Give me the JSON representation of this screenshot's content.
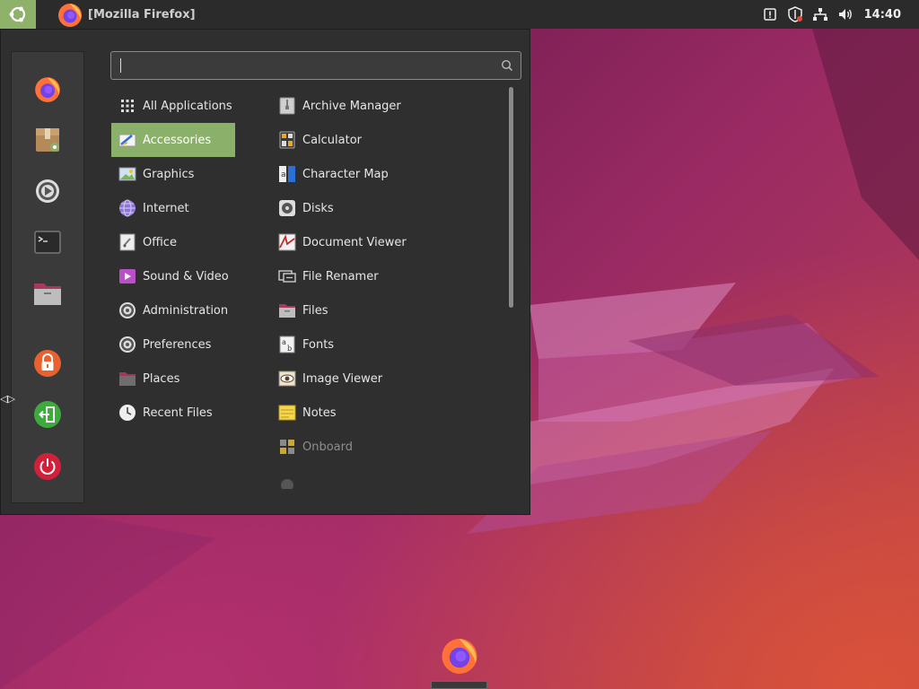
{
  "top_panel": {
    "window_title": "[Mozilla Firefox]",
    "clock": "14:40"
  },
  "favorites": [
    {
      "name": "firefox-icon"
    },
    {
      "name": "software-store-icon"
    },
    {
      "name": "settings-icon"
    },
    {
      "name": "terminal-icon"
    },
    {
      "name": "files-icon"
    },
    {
      "name": "lock-screen-icon"
    },
    {
      "name": "logout-icon"
    },
    {
      "name": "power-icon"
    }
  ],
  "search": {
    "value": ""
  },
  "categories": [
    {
      "label": "All Applications"
    },
    {
      "label": "Accessories"
    },
    {
      "label": "Graphics"
    },
    {
      "label": "Internet"
    },
    {
      "label": "Office"
    },
    {
      "label": "Sound & Video"
    },
    {
      "label": "Administration"
    },
    {
      "label": "Preferences"
    },
    {
      "label": "Places"
    },
    {
      "label": "Recent Files"
    }
  ],
  "apps": [
    {
      "label": "Archive Manager"
    },
    {
      "label": "Calculator"
    },
    {
      "label": "Character Map"
    },
    {
      "label": "Disks"
    },
    {
      "label": "Document Viewer"
    },
    {
      "label": "File Renamer"
    },
    {
      "label": "Files"
    },
    {
      "label": "Fonts"
    },
    {
      "label": "Image Viewer"
    },
    {
      "label": "Notes"
    },
    {
      "label": "Onboard"
    }
  ],
  "colors": {
    "accent": "#8ab06a",
    "panel": "#2b2b2b",
    "menu_bg": "#2f2f2f"
  }
}
